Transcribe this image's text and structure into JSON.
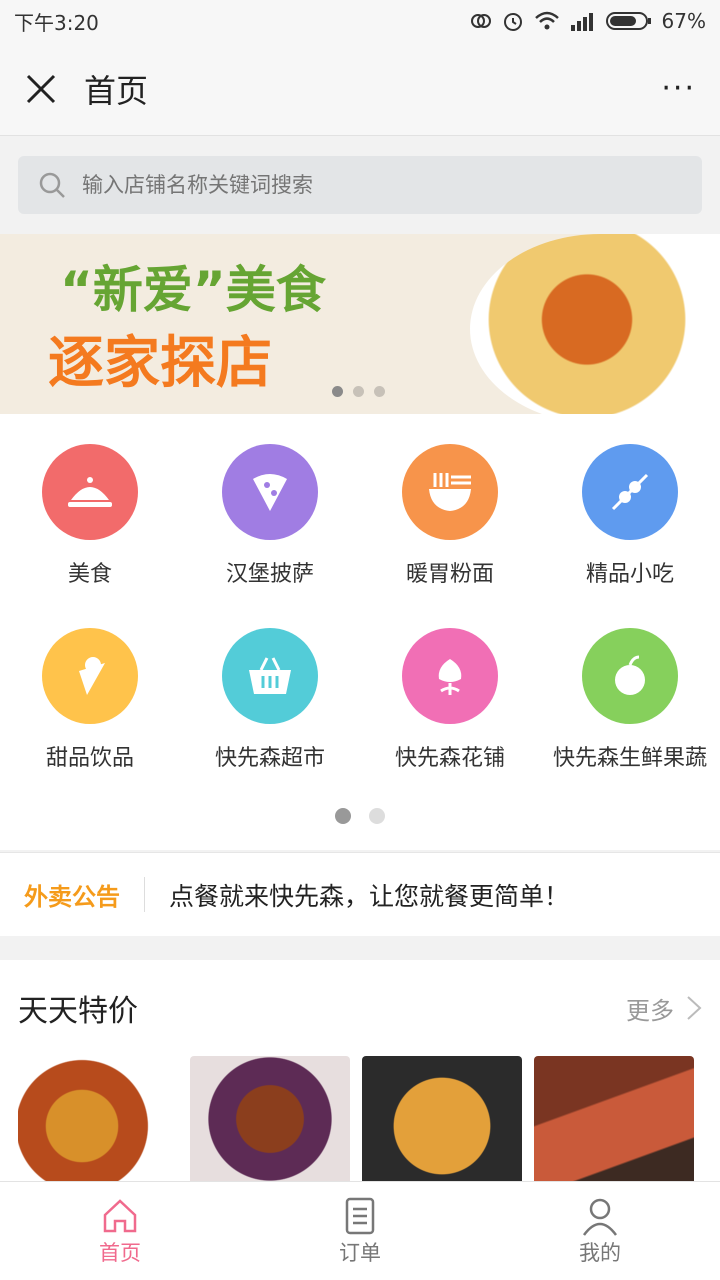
{
  "status_bar": {
    "time": "下午3:20",
    "battery": "67%"
  },
  "nav": {
    "title": "首页",
    "more": "···"
  },
  "search": {
    "placeholder": "输入店铺名称关键词搜索"
  },
  "banner": {
    "line1": "“新爱”美食",
    "line2": "逐家探店"
  },
  "categories": [
    {
      "label": "美食",
      "color": "#f26b6b",
      "icon": "cloche-icon"
    },
    {
      "label": "汉堡披萨",
      "color": "#a07de3",
      "icon": "pizza-icon"
    },
    {
      "label": "暖胃粉面",
      "color": "#f7944b",
      "icon": "noodle-bowl-icon"
    },
    {
      "label": "精品小吃",
      "color": "#5f9bef",
      "icon": "skewer-icon"
    },
    {
      "label": "甜品饮品",
      "color": "#ffc34b",
      "icon": "icecream-icon"
    },
    {
      "label": "快先森超市",
      "color": "#53ccd8",
      "icon": "basket-icon"
    },
    {
      "label": "快先森花铺",
      "color": "#f16fb5",
      "icon": "flower-icon"
    },
    {
      "label": "快先森生鲜果蔬",
      "color": "#86d05c",
      "icon": "apple-icon"
    }
  ],
  "notice": {
    "tag": "外卖公告",
    "text": "点餐就来快先森，让您就餐更简单！"
  },
  "deals": {
    "title": "天天特价",
    "more": "更多"
  },
  "tabbar": [
    {
      "label": "首页",
      "icon": "home-icon",
      "active": true
    },
    {
      "label": "订单",
      "icon": "order-icon",
      "active": false
    },
    {
      "label": "我的",
      "icon": "user-icon",
      "active": false
    }
  ],
  "colors": {
    "accent": "#f06a8d",
    "notice_orange": "#f59b1b"
  }
}
